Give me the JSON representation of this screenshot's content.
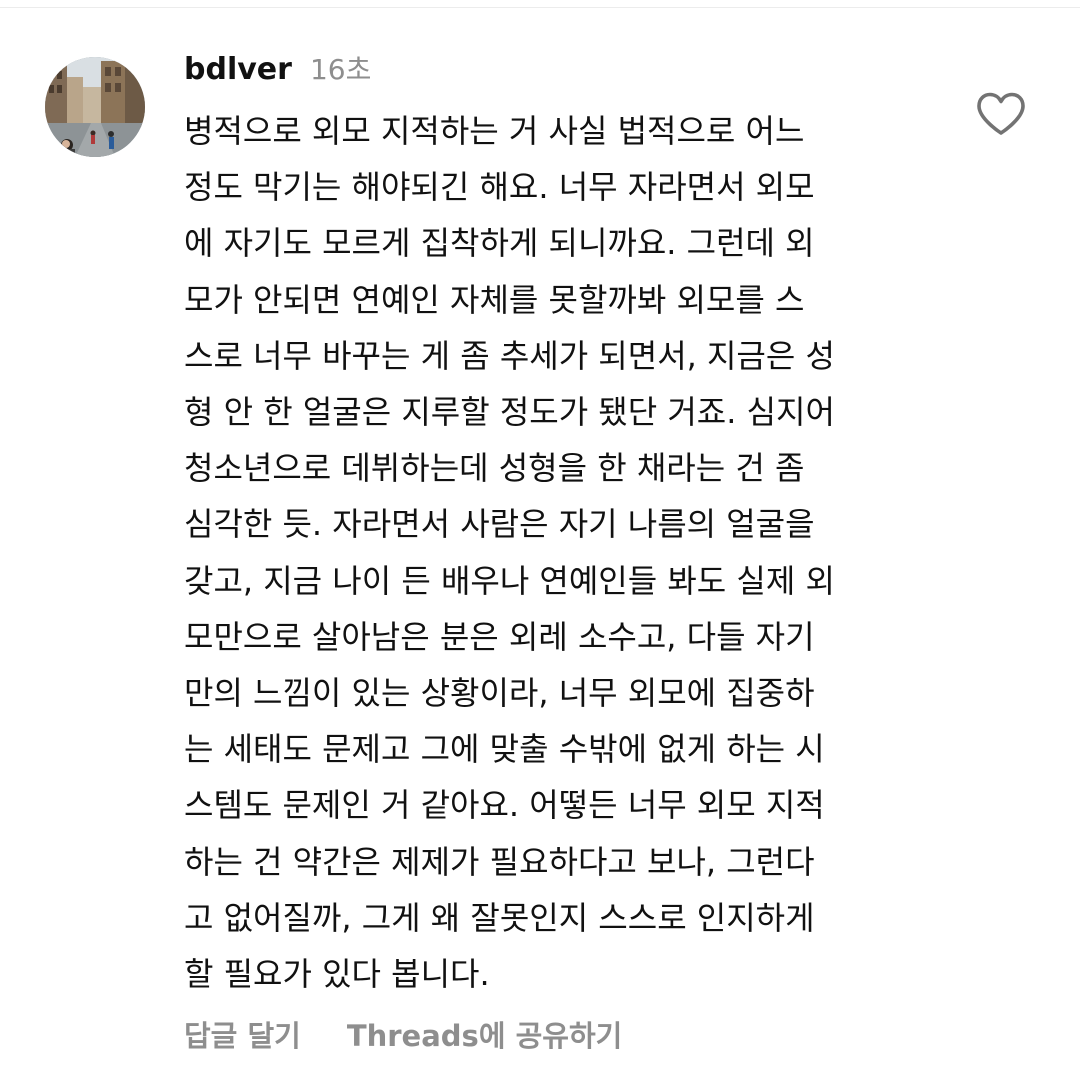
{
  "comment": {
    "username": "bdlver",
    "timestamp": "16초",
    "text_lines": [
      "병적으로 외모 지적하는 거 사실 법적으로 어느",
      "정도 막기는 해야되긴 해요. 너무 자라면서 외모",
      "에 자기도 모르게 집착하게 되니까요. 그런데 외",
      "모가 안되면 연예인 자체를 못할까봐 외모를 스",
      "스로 너무 바꾸는 게 좀 추세가 되면서, 지금은 성",
      "형 안 한 얼굴은 지루할 정도가 됐단 거죠. 심지어",
      "청소년으로 데뷔하는데 성형을 한 채라는 건 좀",
      "심각한 듯. 자라면서 사람은 자기 나름의 얼굴을",
      "갖고, 지금 나이 든 배우나 연예인들 봐도 실제 외",
      "모만으로 살아남은 분은 외레 소수고, 다들 자기",
      "만의 느낌이 있는 상황이라, 너무 외모에 집중하",
      "는 세태도 문제고 그에 맞출 수밖에 없게 하는 시",
      "스템도 문제인 거 같아요. 어떻든 너무 외모 지적",
      "하는 건 약간은 제제가 필요하다고 보나, 그런다",
      "고 없어질까, 그게 왜 잘못인지 스스로 인지하게",
      "할 필요가 있다 봅니다."
    ],
    "like_icon": "heart-outline-icon",
    "avatar_icon": "profile-photo"
  },
  "actions": {
    "reply_label": "답글 달기",
    "share_label": "Threads에 공유하기"
  },
  "colors": {
    "text": "#111111",
    "muted": "#8e8e8e",
    "background": "#ffffff"
  }
}
